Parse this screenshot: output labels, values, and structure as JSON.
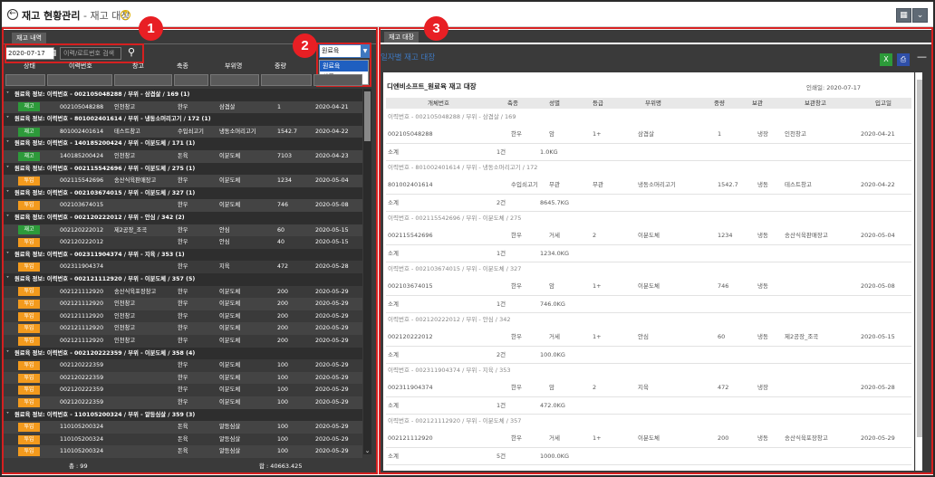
{
  "header": {
    "title": "재고 현황관리",
    "subtitle": " - 재고 대장",
    "help_label": "?"
  },
  "left_panel": {
    "tab_label": "재고 내역",
    "date_value": "2020-07-17",
    "search_placeholder": "이력/로트번호 검색",
    "type_select_value": "원료육",
    "type_options": [
      "원료육",
      "상품"
    ],
    "columns": [
      "상태",
      "이력번호",
      "창고",
      "축종",
      "부위명",
      "중량",
      "입고일"
    ],
    "rows": [
      {
        "kind": "group",
        "text": "원료육 정보: 이력번호 - 002105048288 / 부위 - 삼겹살 / 169 (1)"
      },
      {
        "kind": "data",
        "status": "재고",
        "status_color": "green",
        "lot": "002105048288",
        "wh": "인천창고",
        "sp": "한우",
        "part": "삼겹살",
        "wt": "1",
        "date": "2020-04-21"
      },
      {
        "kind": "group",
        "text": "원료육 정보: 이력번호 - 801002401614 / 부위 - 냉동소머리고기 / 172 (1)"
      },
      {
        "kind": "data",
        "status": "재고",
        "status_color": "green",
        "lot": "801002401614",
        "wh": "테스트창고",
        "sp": "수입쇠고기",
        "part": "냉동소머리고기",
        "wt": "1542.7",
        "date": "2020-04-22"
      },
      {
        "kind": "group",
        "text": "원료육 정보: 이력번호 - 140185200424 / 부위 - 이분도체 / 171 (1)"
      },
      {
        "kind": "data",
        "status": "재고",
        "status_color": "green",
        "lot": "140185200424",
        "wh": "인천창고",
        "sp": "돈육",
        "part": "이분도체",
        "wt": "7103",
        "date": "2020-04-23"
      },
      {
        "kind": "group",
        "text": "원료육 정보: 이력번호 - 002115542696 / 부위 - 이분도체 / 275 (1)"
      },
      {
        "kind": "data",
        "status": "투입",
        "status_color": "orange",
        "lot": "002115542696",
        "wh": "송산식육판매장고",
        "sp": "한우",
        "part": "이분도체",
        "wt": "1234",
        "date": "2020-05-04"
      },
      {
        "kind": "group",
        "text": "원료육 정보: 이력번호 - 002103674015 / 부위 - 이분도체 / 327 (1)"
      },
      {
        "kind": "data",
        "status": "투입",
        "status_color": "orange",
        "lot": "002103674015",
        "wh": "",
        "sp": "한우",
        "part": "이분도체",
        "wt": "746",
        "date": "2020-05-08"
      },
      {
        "kind": "group",
        "text": "원료육 정보: 이력번호 - 002120222012 / 부위 - 안심 / 342 (2)"
      },
      {
        "kind": "data",
        "status": "재고",
        "status_color": "green",
        "lot": "002120222012",
        "wh": "제2공장_조곡",
        "sp": "한우",
        "part": "안심",
        "wt": "60",
        "date": "2020-05-15"
      },
      {
        "kind": "data",
        "status": "투입",
        "status_color": "orange",
        "lot": "002120222012",
        "wh": "",
        "sp": "한우",
        "part": "안심",
        "wt": "40",
        "date": "2020-05-15"
      },
      {
        "kind": "group",
        "text": "원료육 정보: 이력번호 - 002311904374 / 부위 - 지육 / 353 (1)"
      },
      {
        "kind": "data",
        "status": "투입",
        "status_color": "orange",
        "lot": "002311904374",
        "wh": "",
        "sp": "한우",
        "part": "지육",
        "wt": "472",
        "date": "2020-05-28"
      },
      {
        "kind": "group",
        "text": "원료육 정보: 이력번호 - 002121112920 / 부위 - 이분도체 / 357 (5)"
      },
      {
        "kind": "data",
        "status": "투입",
        "status_color": "orange",
        "lot": "002121112920",
        "wh": "송산식육포장창고",
        "sp": "한우",
        "part": "이분도체",
        "wt": "200",
        "date": "2020-05-29"
      },
      {
        "kind": "data",
        "status": "투입",
        "status_color": "orange",
        "lot": "002121112920",
        "wh": "인천창고",
        "sp": "한우",
        "part": "이분도체",
        "wt": "200",
        "date": "2020-05-29"
      },
      {
        "kind": "data",
        "status": "투입",
        "status_color": "orange",
        "lot": "002121112920",
        "wh": "인천창고",
        "sp": "한우",
        "part": "이분도체",
        "wt": "200",
        "date": "2020-05-29"
      },
      {
        "kind": "data",
        "status": "투입",
        "status_color": "orange",
        "lot": "002121112920",
        "wh": "인천창고",
        "sp": "한우",
        "part": "이분도체",
        "wt": "200",
        "date": "2020-05-29"
      },
      {
        "kind": "data",
        "status": "투입",
        "status_color": "orange",
        "lot": "002121112920",
        "wh": "인천창고",
        "sp": "한우",
        "part": "이분도체",
        "wt": "200",
        "date": "2020-05-29"
      },
      {
        "kind": "group",
        "text": "원료육 정보: 이력번호 - 002120222359 / 부위 - 이분도체 / 358 (4)"
      },
      {
        "kind": "data",
        "status": "투입",
        "status_color": "orange",
        "lot": "002120222359",
        "wh": "",
        "sp": "한우",
        "part": "이분도체",
        "wt": "100",
        "date": "2020-05-29"
      },
      {
        "kind": "data",
        "status": "투입",
        "status_color": "orange",
        "lot": "002120222359",
        "wh": "",
        "sp": "한우",
        "part": "이분도체",
        "wt": "100",
        "date": "2020-05-29"
      },
      {
        "kind": "data",
        "status": "투입",
        "status_color": "orange",
        "lot": "002120222359",
        "wh": "",
        "sp": "한우",
        "part": "이분도체",
        "wt": "100",
        "date": "2020-05-29"
      },
      {
        "kind": "data",
        "status": "투입",
        "status_color": "orange",
        "lot": "002120222359",
        "wh": "",
        "sp": "한우",
        "part": "이분도체",
        "wt": "100",
        "date": "2020-05-29"
      },
      {
        "kind": "group",
        "text": "원료육 정보: 이력번호 - 110105200324 / 부위 - 알등심살 / 359 (3)"
      },
      {
        "kind": "data",
        "status": "투입",
        "status_color": "orange",
        "lot": "110105200324",
        "wh": "",
        "sp": "돈육",
        "part": "알등심살",
        "wt": "100",
        "date": "2020-05-29"
      },
      {
        "kind": "data",
        "status": "투입",
        "status_color": "orange",
        "lot": "110105200324",
        "wh": "",
        "sp": "돈육",
        "part": "알등심살",
        "wt": "100",
        "date": "2020-05-29"
      },
      {
        "kind": "data",
        "status": "투입",
        "status_color": "orange",
        "lot": "110105200324",
        "wh": "",
        "sp": "돈육",
        "part": "알등심살",
        "wt": "100",
        "date": "2020-05-29"
      }
    ],
    "footer_count": "총 : 99",
    "footer_sum": "합 : 40663.425"
  },
  "right_panel": {
    "tab_label": "재고 대장",
    "heading": "일자별 재고 대장",
    "doc_title": "디엔비소프트_원료육 재고 대장",
    "print_date": "인쇄일: 2020-07-17",
    "columns": [
      "개체번호",
      "축종",
      "성별",
      "등급",
      "부위명",
      "중량",
      "보관",
      "보관창고",
      "입고일"
    ],
    "rows": [
      {
        "kind": "info",
        "text": "이력번호 - 002105048288 / 부위 - 삼겹살 / 169"
      },
      {
        "kind": "item",
        "cells": [
          "002105048288",
          "한우",
          "암",
          "1+",
          "삼겹살",
          "1",
          "냉장",
          "인천창고",
          "2020-04-21"
        ]
      },
      {
        "kind": "sub",
        "label": "소계",
        "count": "1건",
        "weight": "1.0KG"
      },
      {
        "kind": "info",
        "text": "이력번호 - 801002401614 / 부위 - 냉동소머리고기 / 172"
      },
      {
        "kind": "item",
        "cells": [
          "801002401614",
          "수입쇠고기",
          "무관",
          "무관",
          "냉동소머리고기",
          "1542.7",
          "냉동",
          "테스트창고",
          "2020-04-22"
        ]
      },
      {
        "kind": "sub",
        "label": "소계",
        "count": "2건",
        "weight": "8645.7KG"
      },
      {
        "kind": "info",
        "text": "이력번호 - 002115542696 / 부위 - 이분도체 / 275"
      },
      {
        "kind": "item",
        "cells": [
          "002115542696",
          "한우",
          "거세",
          "2",
          "이분도체",
          "1234",
          "냉동",
          "송산식육판매장고",
          "2020-05-04"
        ]
      },
      {
        "kind": "sub",
        "label": "소계",
        "count": "1건",
        "weight": "1234.0KG"
      },
      {
        "kind": "info",
        "text": "이력번호 - 002103674015 / 부위 - 이분도체 / 327"
      },
      {
        "kind": "item",
        "cells": [
          "002103674015",
          "한우",
          "암",
          "1+",
          "이분도체",
          "746",
          "냉동",
          "",
          "2020-05-08"
        ]
      },
      {
        "kind": "sub",
        "label": "소계",
        "count": "1건",
        "weight": "746.0KG"
      },
      {
        "kind": "info",
        "text": "이력번호 - 002120222012 / 부위 - 안심 / 342"
      },
      {
        "kind": "item",
        "cells": [
          "002120222012",
          "한우",
          "거세",
          "1+",
          "안심",
          "60",
          "냉동",
          "제2공장_조곡",
          "2020-05-15"
        ]
      },
      {
        "kind": "sub",
        "label": "소계",
        "count": "2건",
        "weight": "100.0KG"
      },
      {
        "kind": "info",
        "text": "이력번호 - 002311904374 / 부위 - 지육 / 353"
      },
      {
        "kind": "item",
        "cells": [
          "002311904374",
          "한우",
          "암",
          "2",
          "지육",
          "472",
          "냉장",
          "",
          "2020-05-28"
        ]
      },
      {
        "kind": "sub",
        "label": "소계",
        "count": "1건",
        "weight": "472.0KG"
      },
      {
        "kind": "info",
        "text": "이력번호 - 002121112920 / 부위 - 이분도체 / 357"
      },
      {
        "kind": "item",
        "cells": [
          "002121112920",
          "한우",
          "거세",
          "1+",
          "이분도체",
          "200",
          "냉동",
          "송산식육포장창고",
          "2020-05-29"
        ]
      },
      {
        "kind": "sub",
        "label": "소계",
        "count": "5건",
        "weight": "1000.0KG"
      }
    ]
  },
  "annotations": [
    "1",
    "2",
    "3"
  ]
}
